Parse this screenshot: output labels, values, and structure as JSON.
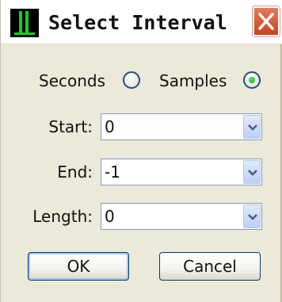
{
  "window": {
    "title": "Select Interval",
    "colors": {
      "face": "#ece9d8",
      "titlebar": "#ffffff",
      "close_button": "#d9542c",
      "radio_selected": "#21a121"
    }
  },
  "mode": {
    "options": [
      {
        "label": "Seconds",
        "selected": false
      },
      {
        "label": "Samples",
        "selected": true
      }
    ]
  },
  "fields": {
    "start": {
      "label": "Start:",
      "value": "0"
    },
    "end": {
      "label": "End:",
      "value": "-1"
    },
    "length": {
      "label": "Length:",
      "value": "0"
    }
  },
  "buttons": {
    "ok": "OK",
    "cancel": "Cancel"
  },
  "icons": {
    "app": "app-waveform-icon",
    "close": "close-icon",
    "dropdown": "chevron-down-icon"
  }
}
